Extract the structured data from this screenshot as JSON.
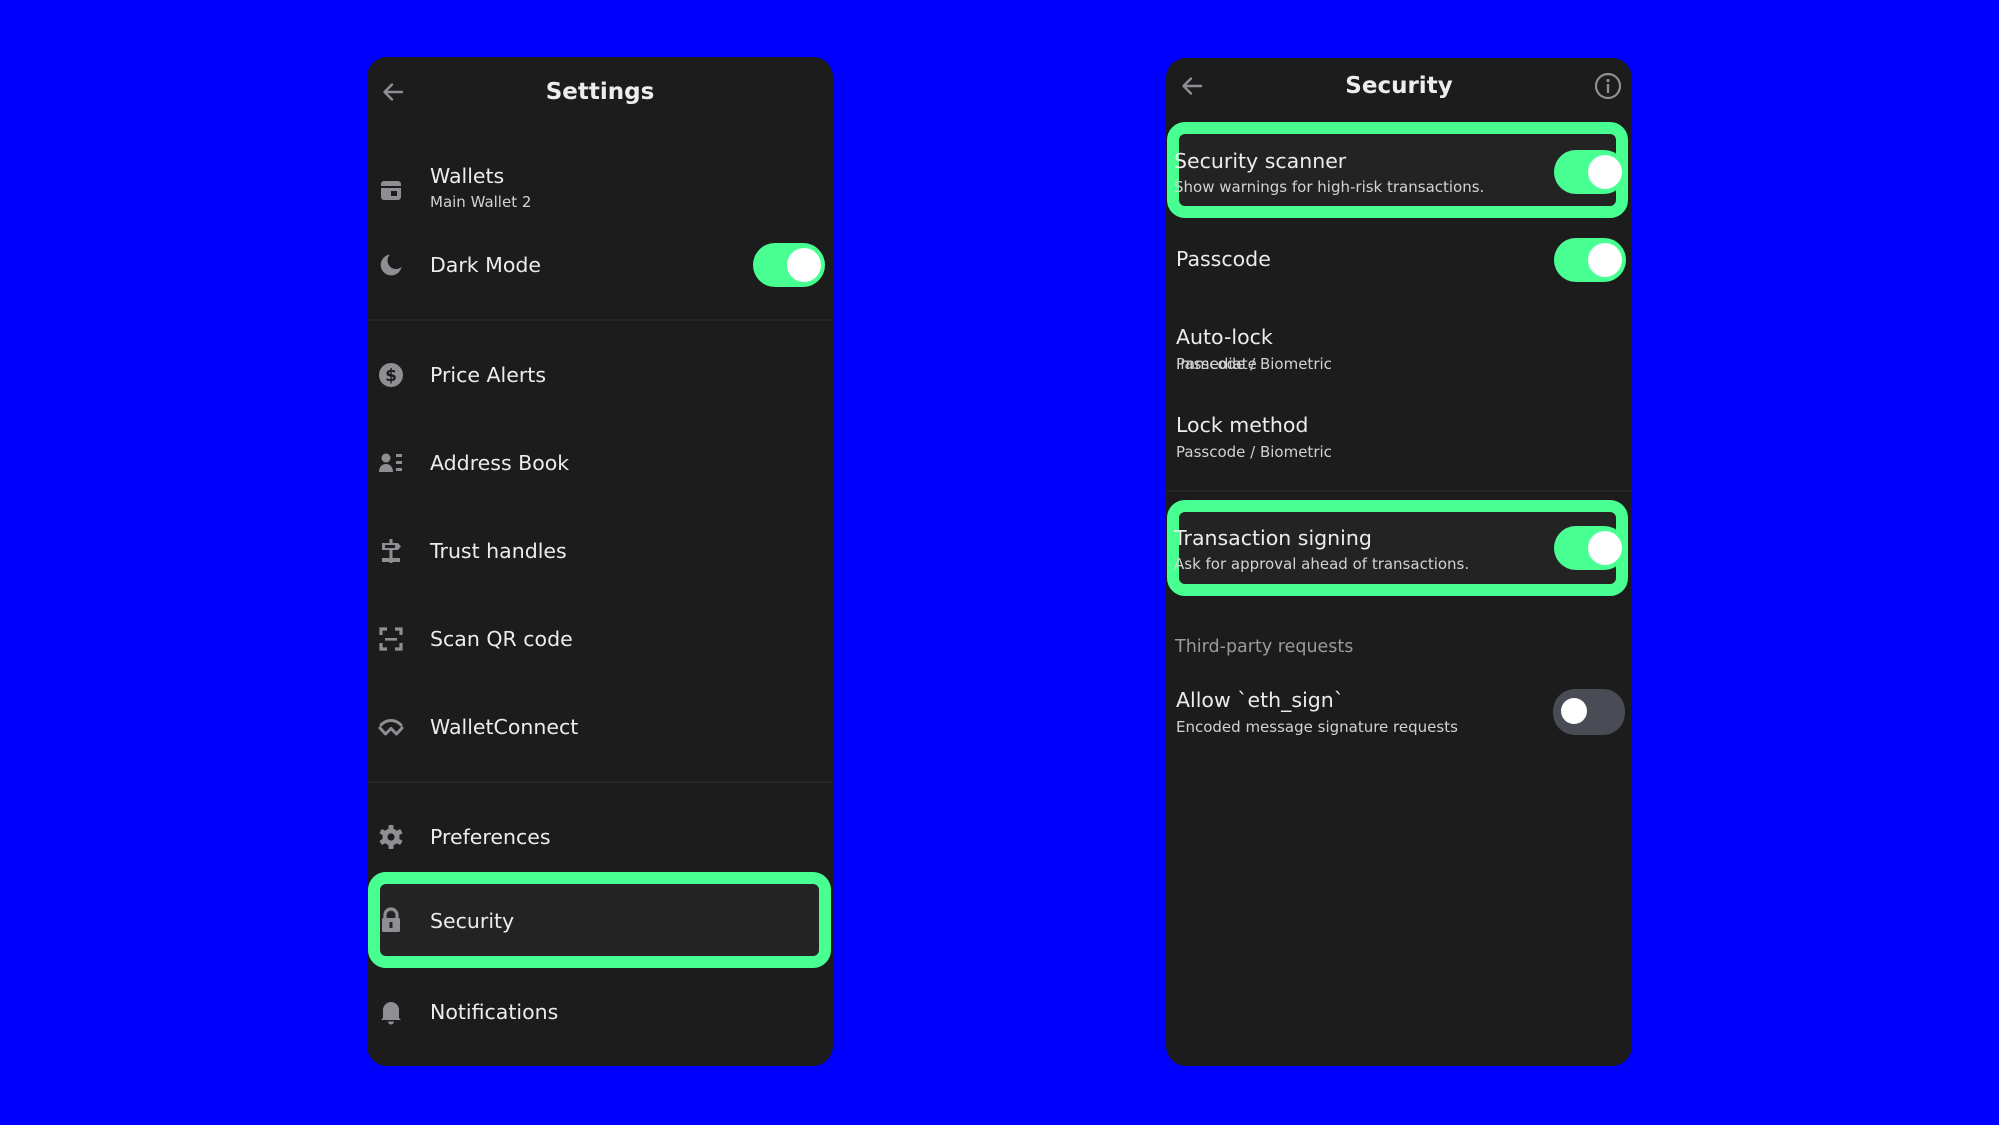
{
  "colors": {
    "background": "#0000FF",
    "panel": "#1C1C1C",
    "accent": "#48FF91",
    "toggle_off": "#4A4C55",
    "icon": "#8E8E93"
  },
  "settings": {
    "title": "Settings",
    "back_icon": "arrow-left-icon",
    "items": [
      {
        "id": "wallets",
        "label": "Wallets",
        "sublabel": "Main Wallet 2",
        "icon": "wallet-icon"
      },
      {
        "id": "dark-mode",
        "label": "Dark Mode",
        "icon": "moon-icon",
        "toggle": true
      },
      {
        "id": "price-alerts",
        "label": "Price Alerts",
        "icon": "dollar-circle-icon"
      },
      {
        "id": "address-book",
        "label": "Address Book",
        "icon": "contact-list-icon"
      },
      {
        "id": "trust-handles",
        "label": "Trust handles",
        "icon": "signpost-icon"
      },
      {
        "id": "scan-qr",
        "label": "Scan QR code",
        "icon": "scan-icon"
      },
      {
        "id": "walletconnect",
        "label": "WalletConnect",
        "icon": "walletconnect-icon"
      },
      {
        "id": "preferences",
        "label": "Preferences",
        "icon": "gear-icon"
      },
      {
        "id": "security",
        "label": "Security",
        "icon": "lock-icon",
        "highlighted": true
      },
      {
        "id": "notifications",
        "label": "Notifications",
        "icon": "bell-icon"
      }
    ]
  },
  "security": {
    "title": "Security",
    "back_icon": "arrow-left-icon",
    "info_icon": "info-icon",
    "items": [
      {
        "id": "security-scanner",
        "label": "Security scanner",
        "sublabel": "Show warnings for high-risk transactions.",
        "toggle": true,
        "highlighted": true
      },
      {
        "id": "passcode",
        "label": "Passcode",
        "toggle": true
      },
      {
        "id": "auto-lock",
        "label": "Auto-lock",
        "sublabel": "Immediate"
      },
      {
        "id": "lock-method",
        "label": "Lock method",
        "sublabel": "Passcode / Biometric"
      },
      {
        "id": "transaction-signing",
        "label": "Transaction signing",
        "sublabel": "Ask for approval ahead of transactions.",
        "toggle": true,
        "highlighted": true
      }
    ],
    "section_label": "Third-party requests",
    "third_party": [
      {
        "id": "allow-eth-sign",
        "label": "Allow `eth_sign`",
        "sublabel": "Encoded message signature requests",
        "toggle": false
      }
    ]
  }
}
